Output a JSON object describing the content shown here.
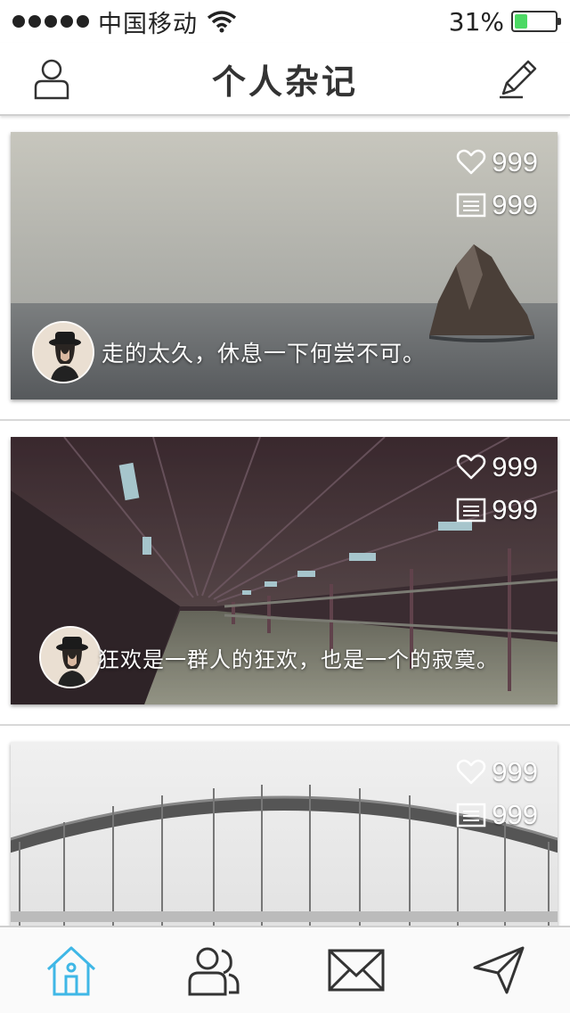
{
  "status_bar": {
    "carrier": "中国移动",
    "battery_percent": "31%",
    "battery_level": 0.31,
    "battery_color": "#4cd964"
  },
  "nav": {
    "title": "个人杂记",
    "left_icon": "user-icon",
    "right_icon": "pencil-icon"
  },
  "posts": [
    {
      "likes": "999",
      "comments": "999",
      "caption": "走的太久，休息一下何尝不可。",
      "image": "sea-rock"
    },
    {
      "likes": "999",
      "comments": "999",
      "caption": "狂欢是一群人的狂欢，也是一个的寂寞。",
      "image": "covered-bridge"
    },
    {
      "likes": "999",
      "comments": "999",
      "caption": "",
      "image": "arch-bridge"
    }
  ],
  "tab_bar": {
    "accent": "#3fb7e6",
    "tabs": [
      {
        "icon": "home-icon",
        "active": true
      },
      {
        "icon": "friends-icon",
        "active": false
      },
      {
        "icon": "mail-icon",
        "active": false
      },
      {
        "icon": "send-icon",
        "active": false
      }
    ]
  }
}
